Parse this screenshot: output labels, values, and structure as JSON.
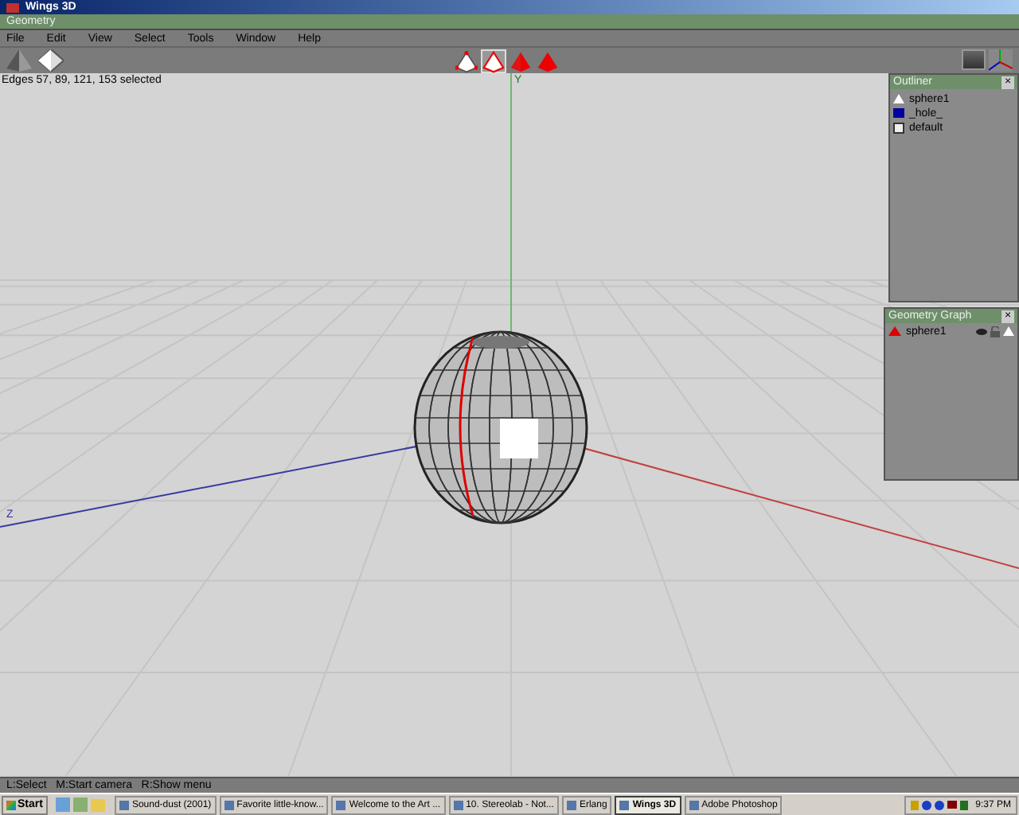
{
  "window": {
    "title": "Wings 3D"
  },
  "panel_title": "Geometry",
  "menu": [
    "File",
    "Edit",
    "View",
    "Select",
    "Tools",
    "Window",
    "Help"
  ],
  "select_modes": [
    {
      "kind": "vertex",
      "selected": false
    },
    {
      "kind": "edge",
      "selected": true
    },
    {
      "kind": "face",
      "selected": false
    },
    {
      "kind": "body",
      "selected": false
    }
  ],
  "viewport": {
    "info": "Edges 57, 89, 121, 153 selected",
    "axis_labels": [
      {
        "text": "Y",
        "color": "#1f7a1f"
      },
      {
        "text": "Z",
        "color": "#3030a0"
      }
    ]
  },
  "outliner": {
    "title": "Outliner",
    "close": "×",
    "items": [
      {
        "kind": "object",
        "label": "sphere1"
      },
      {
        "kind": "hole",
        "label": "_hole_"
      },
      {
        "kind": "material",
        "label": "default"
      }
    ]
  },
  "geometry_graph": {
    "title": "Geometry Graph",
    "close": "×",
    "items": [
      {
        "label": "sphere1",
        "visible": true,
        "locked": false
      }
    ]
  },
  "status_bar": "L:Select   M:Start camera   R:Show menu",
  "taskbar": {
    "start": "Start",
    "tasks": [
      {
        "label": "Sound-dust (2001)",
        "selected": false
      },
      {
        "label": "Favorite little-know...",
        "selected": false
      },
      {
        "label": "Welcome to the Art ...",
        "selected": false
      },
      {
        "label": "10. Stereolab - Not...",
        "selected": false
      },
      {
        "label": "Erlang",
        "selected": false
      },
      {
        "label": "Wings 3D",
        "selected": true
      },
      {
        "label": "Adobe Photoshop",
        "selected": false
      }
    ],
    "clock": "9:37 PM"
  }
}
